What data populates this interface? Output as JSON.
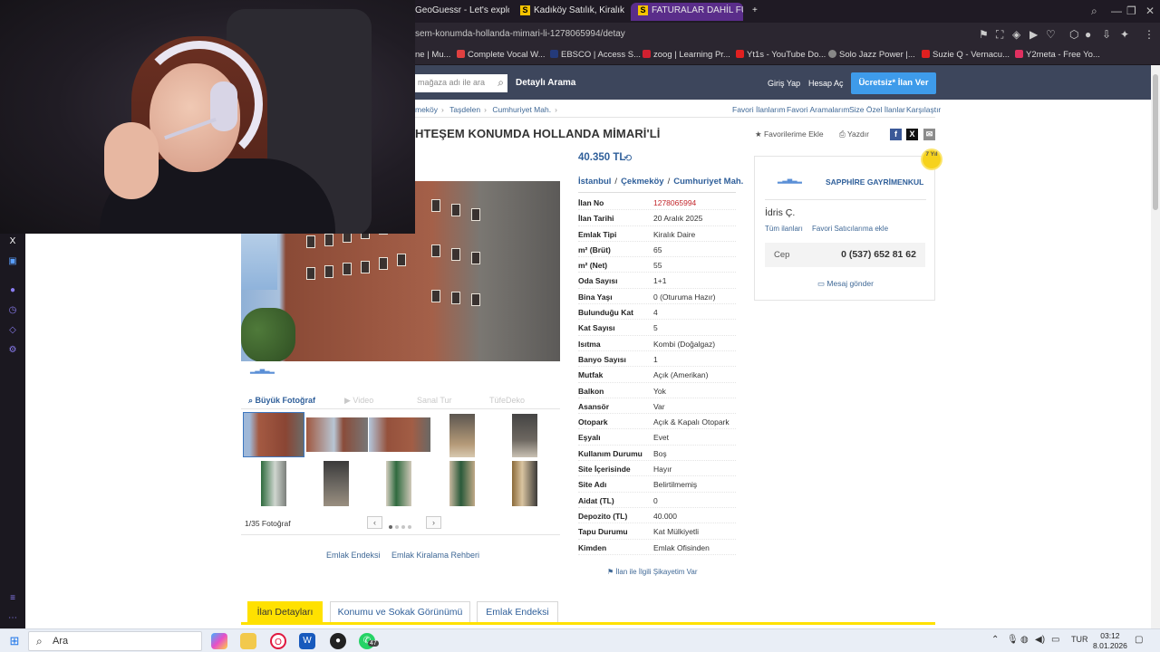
{
  "browser": {
    "tabs": [
      {
        "label": "GeoGuessr - Let's explore"
      },
      {
        "label": "Kadıköy Satılık, Kiralık Em",
        "icon": "S"
      },
      {
        "label": "FATURALAR DAHİL FULL E",
        "icon": "S"
      }
    ],
    "new_tab": "+",
    "url": "sem-konumda-hollanda-mimari-li-1278065994/detay",
    "bookmarks": [
      {
        "label": "ne | Mu...",
        "color": "#999"
      },
      {
        "label": "Complete Vocal W...",
        "color": "#e04040"
      },
      {
        "label": "EBSCO | Access S...",
        "color": "#243a7a"
      },
      {
        "label": "zoog | Learning Pr...",
        "color": "#d02030"
      },
      {
        "label": "Yt1s - YouTube Do...",
        "color": "#e02020"
      },
      {
        "label": "Solo Jazz Power |...",
        "color": "#888"
      },
      {
        "label": "Suzie Q - Vernacu...",
        "color": "#e02020"
      },
      {
        "label": "Y2meta - Free Yo...",
        "color": "#e03060"
      }
    ]
  },
  "header": {
    "search_placeholder": "mağaza adı ile ara",
    "detail_search": "Detaylı Arama",
    "login": "Giriş Yap",
    "register": "Hesap Aç",
    "cta": "Ücretsiz* İlan Ver"
  },
  "breadcrumb": [
    "meköy",
    "Taşdelen",
    "Cumhuriyet Mah."
  ],
  "top_links": [
    "Favori İlanlarım",
    "Favori Aramalarım",
    "Size Özel İlanlar",
    "Karşılaştır"
  ],
  "title": "HTEŞEM KONUMDA HOLLANDA MİMARİ'Lİ",
  "actions": {
    "favorite": "Favorilerime Ekle",
    "print": "Yazdır"
  },
  "photo": {
    "tabs": [
      "Büyük Fotoğraf",
      "Video",
      "Sanal Tur",
      "TüfeDeko"
    ],
    "count": "1/35 Fotoğraf",
    "prev": "‹",
    "next": "›"
  },
  "below_links": [
    "Emlak Endeksi",
    "Emlak Kiralama Rehberi"
  ],
  "listing": {
    "price": "40.350 TL",
    "location": [
      "İstanbul",
      "Çekmeköy",
      "Cumhuriyet Mah."
    ],
    "loc_sep": "/",
    "rows": [
      {
        "k": "İlan No",
        "v": "1278065994"
      },
      {
        "k": "İlan Tarihi",
        "v": "20 Aralık 2025"
      },
      {
        "k": "Emlak Tipi",
        "v": "Kiralık Daire"
      },
      {
        "k": "m² (Brüt)",
        "v": "65"
      },
      {
        "k": "m² (Net)",
        "v": "55"
      },
      {
        "k": "Oda Sayısı",
        "v": "1+1"
      },
      {
        "k": "Bina Yaşı",
        "v": "0 (Oturuma Hazır)"
      },
      {
        "k": "Bulunduğu Kat",
        "v": "4"
      },
      {
        "k": "Kat Sayısı",
        "v": "5"
      },
      {
        "k": "Isıtma",
        "v": "Kombi (Doğalgaz)"
      },
      {
        "k": "Banyo Sayısı",
        "v": "1"
      },
      {
        "k": "Mutfak",
        "v": "Açık (Amerikan)"
      },
      {
        "k": "Balkon",
        "v": "Yok"
      },
      {
        "k": "Asansör",
        "v": "Var"
      },
      {
        "k": "Otopark",
        "v": "Açık & Kapalı Otopark"
      },
      {
        "k": "Eşyalı",
        "v": "Evet"
      },
      {
        "k": "Kullanım Durumu",
        "v": "Boş"
      },
      {
        "k": "Site İçerisinde",
        "v": "Hayır"
      },
      {
        "k": "Site Adı",
        "v": "Belirtilmemiş"
      },
      {
        "k": "Aidat (TL)",
        "v": "0"
      },
      {
        "k": "Depozito (TL)",
        "v": "40.000"
      },
      {
        "k": "Tapu Durumu",
        "v": "Kat Mülkiyetli"
      },
      {
        "k": "Kimden",
        "v": "Emlak Ofisinden"
      }
    ],
    "complain": "İlan ile İlgili Şikayetim Var"
  },
  "seller": {
    "badge": "7 Yıl",
    "name": "SAPPHİRE GAYRİMENKUL",
    "person": "İdris Ç.",
    "all_listings": "Tüm ilanları",
    "fav_seller": "Favori Satıcılarıma ekle",
    "phone_label": "Cep",
    "phone": "0 (537) 652 81 62",
    "message": "Mesaj gönder"
  },
  "bottom_tabs": [
    "İlan Detayları",
    "Konumu ve Sokak Görünümü",
    "Emlak Endeksi"
  ],
  "taskbar": {
    "search": "Ara",
    "badge_count": "47",
    "lang": "TUR",
    "time": "03:12",
    "date": "8.01.2026"
  }
}
